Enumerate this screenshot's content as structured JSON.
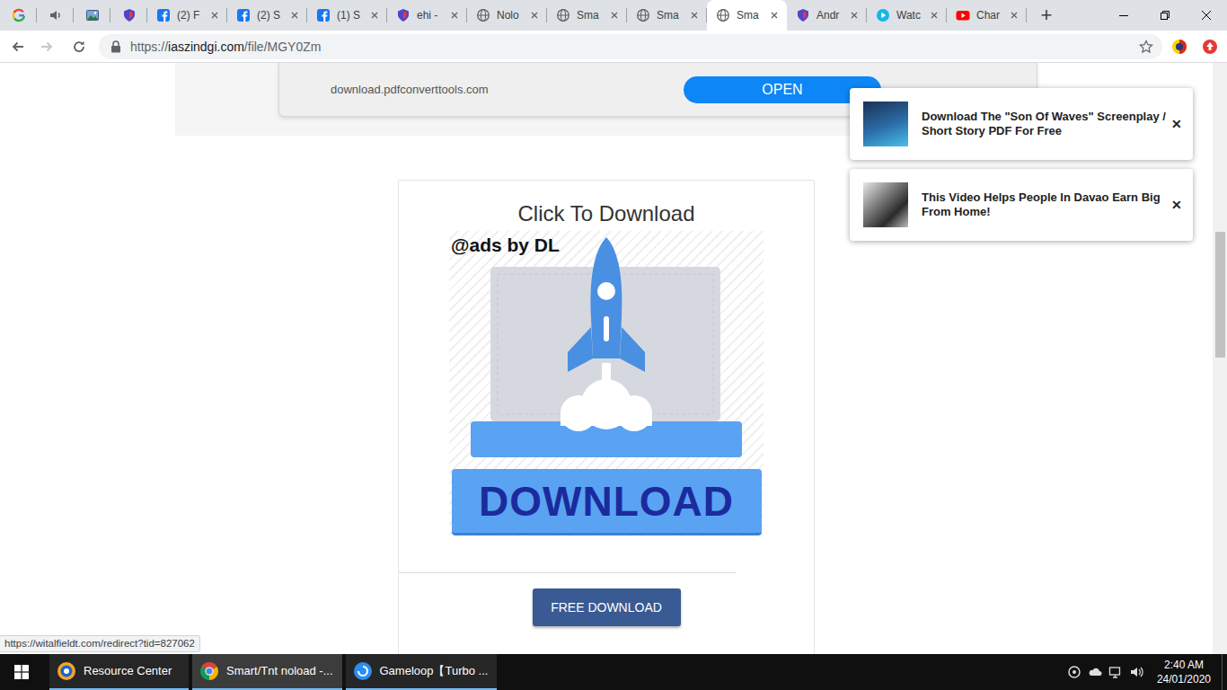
{
  "browser": {
    "tabs": [
      {
        "kind": "pinned",
        "selected": false
      },
      {
        "kind": "pinned",
        "selected": false
      },
      {
        "kind": "pinned",
        "selected": false
      },
      {
        "kind": "pinned",
        "selected": false
      },
      {
        "kind": "normal",
        "label": "(2) F",
        "selected": false
      },
      {
        "kind": "normal",
        "label": "(2) S",
        "selected": false
      },
      {
        "kind": "normal",
        "label": "(1) S",
        "selected": false
      },
      {
        "kind": "normal",
        "label": "ehi -",
        "selected": false
      },
      {
        "kind": "normal",
        "label": "Nolo",
        "selected": false
      },
      {
        "kind": "normal",
        "label": "Sma",
        "selected": false
      },
      {
        "kind": "normal",
        "label": "Sma",
        "selected": false
      },
      {
        "kind": "normal",
        "label": "Sma",
        "selected": true
      },
      {
        "kind": "normal",
        "label": "Andr",
        "selected": false
      },
      {
        "kind": "normal",
        "label": "Watc",
        "selected": false
      },
      {
        "kind": "normal",
        "label": "Char",
        "selected": false
      }
    ],
    "new_tab": "+",
    "nav": {
      "back_disabled": false,
      "forward_disabled": true
    },
    "address": {
      "scheme": "https://",
      "host": "iaszindgi.com",
      "path": "/file/MGY0Zm"
    },
    "status_url": "https://witalfieldt.com/redirect?tid=827062"
  },
  "page": {
    "ad_bar": {
      "domain": "download.pdfconverttools.com",
      "button": "OPEN"
    },
    "download_card": {
      "title": "Click To Download",
      "ad_label": "@ads by DL",
      "ad_button": "DOWNLOAD",
      "button": "FREE DOWNLOAD"
    }
  },
  "notifications": [
    {
      "text": "Download The \"Son Of Waves\" Screenplay / Short Story PDF For Free",
      "close": "✕"
    },
    {
      "text": "This Video Helps People In Davao Earn Big From Home!",
      "close": "✕"
    }
  ],
  "taskbar": {
    "items": [
      {
        "label": "Resource Center",
        "selected": false
      },
      {
        "label": "Smart/Tnt noload -...",
        "selected": true
      },
      {
        "label": "Gameloop【Turbo ...",
        "selected": false
      }
    ],
    "time": "2:40 AM",
    "date": "24/01/2020"
  }
}
